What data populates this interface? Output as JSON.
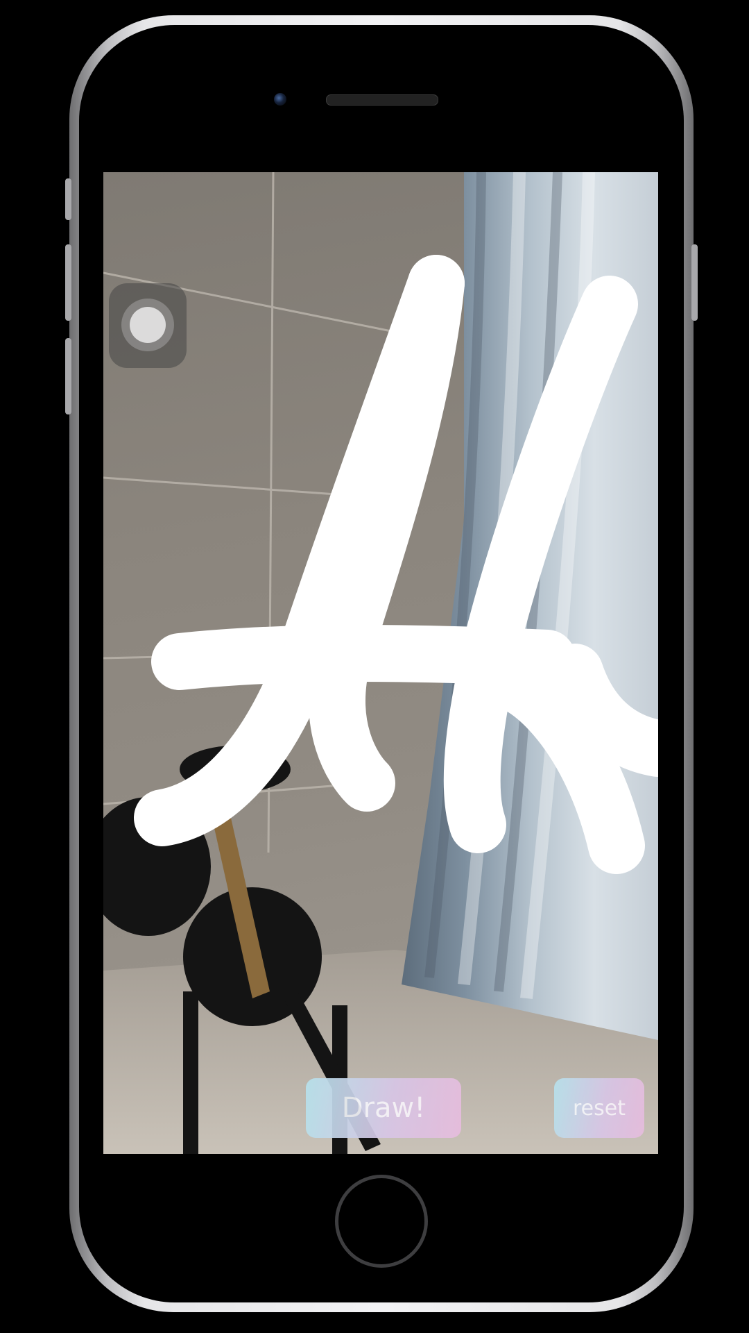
{
  "app": {
    "draw_button_label": "Draw!",
    "reset_button_label": "reset"
  },
  "icons": {
    "assistive_touch": "assistive-touch-icon",
    "home_button": "home-button-icon"
  },
  "colors": {
    "button_gradient_start": "#b6e2ec",
    "button_gradient_end": "#e7bcde",
    "stroke": "#ffffff"
  }
}
